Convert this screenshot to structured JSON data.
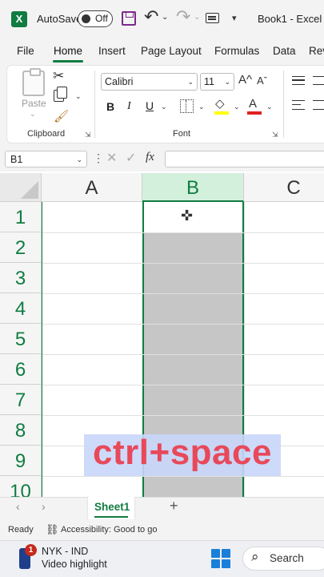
{
  "titlebar": {
    "logo": "X",
    "autosave_label": "AutoSave",
    "autosave_state": "Off",
    "doc_title": "Book1 - Excel",
    "icons": [
      "excel-logo-icon",
      "save-icon",
      "undo-icon",
      "redo-icon",
      "form-icon",
      "customize-qat-icon"
    ]
  },
  "tabs": [
    "File",
    "Home",
    "Insert",
    "Page Layout",
    "Formulas",
    "Data",
    "Rev"
  ],
  "ribbon": {
    "clipboard": {
      "paste_label": "Paste",
      "group_label": "Clipboard"
    },
    "font": {
      "font_name": "Calibri",
      "font_size": "11",
      "bold": "B",
      "italic": "I",
      "underline": "U",
      "grow": "A^",
      "shrink": "Aˇ",
      "fill_glyph": "◇",
      "fontcolor_glyph": "A",
      "group_label": "Font",
      "fill_color": "#ffff00",
      "font_color": "#e02020"
    }
  },
  "formula_bar": {
    "name_box": "B1",
    "fx": "fx",
    "cancel": "✕",
    "enter": "✓",
    "formula": ""
  },
  "grid": {
    "columns": [
      "A",
      "B",
      "C"
    ],
    "rows": [
      "1",
      "2",
      "3",
      "4",
      "5",
      "6",
      "7",
      "8",
      "9",
      "10"
    ],
    "selected_column": "B",
    "active_cell": "B1",
    "accent": "#107c41"
  },
  "caption": "ctrl+space",
  "sheets": {
    "active": "Sheet1",
    "add": "+"
  },
  "status": {
    "ready": "Ready",
    "accessibility": "Accessibility: Good to go"
  },
  "taskbar": {
    "badge": "1",
    "widget_line1": "NYK - IND",
    "widget_line2": "Video highlight",
    "search_label": "Search"
  }
}
